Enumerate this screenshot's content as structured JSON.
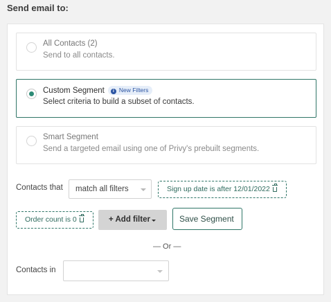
{
  "header": {
    "title": "Send email to:"
  },
  "options": [
    {
      "title": "All Contacts (2)",
      "description": "Send to all contacts.",
      "selected": false
    },
    {
      "title": "Custom Segment",
      "badge": "New Filters",
      "description": "Select criteria to build a subset of contacts.",
      "selected": true
    },
    {
      "title": "Smart Segment",
      "description": "Send a targeted email using one of Privy's prebuilt segments.",
      "selected": false
    }
  ],
  "filters": {
    "contacts_that_label": "Contacts that",
    "match_select": "match all filters",
    "chips": [
      "Sign up date is after 12/01/2022",
      "Order count is 0"
    ],
    "add_filter_label": "+ Add filter",
    "save_segment_label": "Save Segment"
  },
  "divider": {
    "label": "— Or —"
  },
  "contacts_in": {
    "label": "Contacts in",
    "value": ""
  },
  "colors": {
    "accent": "#2f7567",
    "radio_fill": "#2d8b76",
    "badge_bg": "#e6eef9",
    "badge_text": "#2d55a3"
  },
  "icons": {
    "badge_icon": "info-icon",
    "chip_icon": "trash-icon",
    "select_icon": "chevron-down-icon"
  }
}
